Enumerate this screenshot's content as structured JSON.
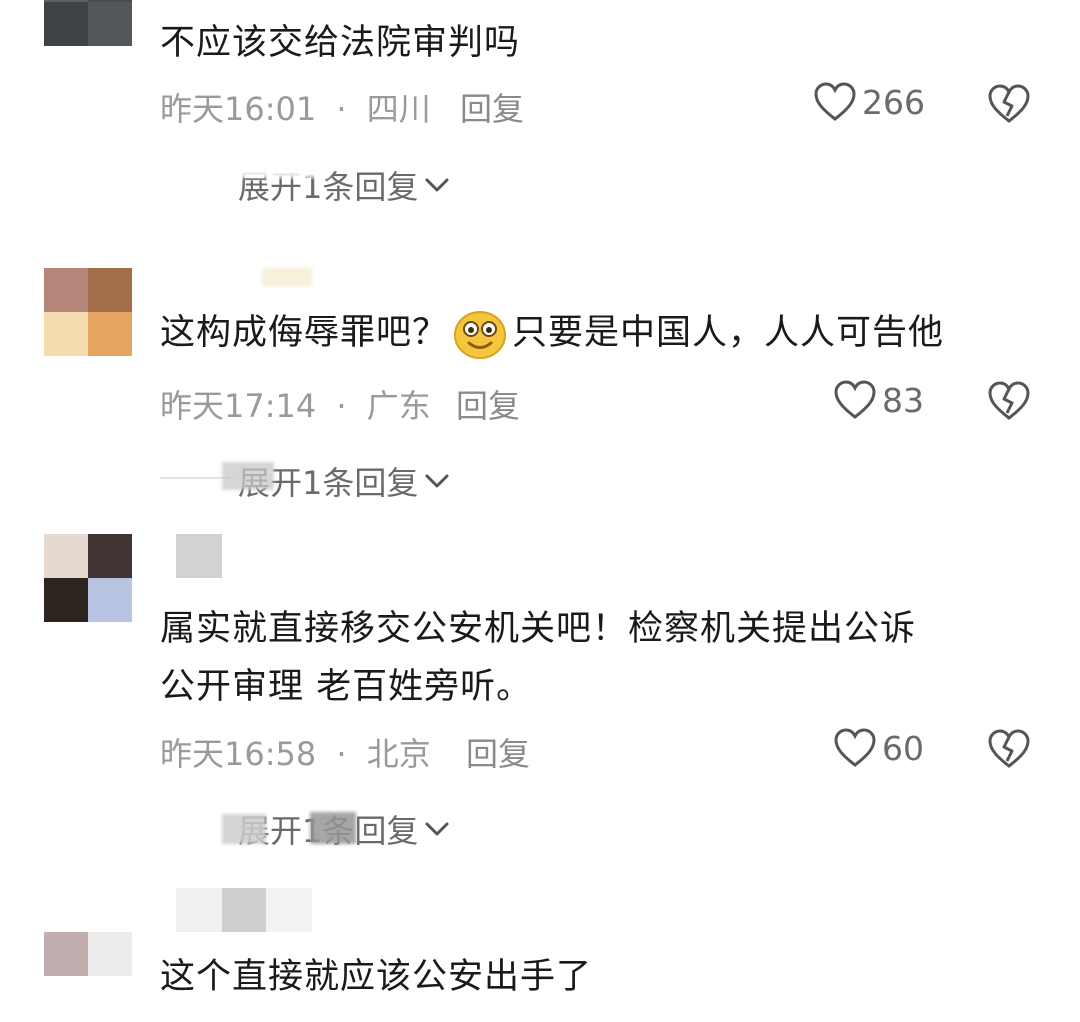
{
  "comments": [
    {
      "text": "不应该交给法院审判吗",
      "time": "昨天16:01",
      "location": "四川",
      "reply": "回复",
      "likes": "266",
      "expand": "展开1条回复"
    },
    {
      "text_before_emoji": "这构成侮辱罪吧？",
      "text_after_emoji": "只要是中国人，人人可告他",
      "emoji": "smiling-face-emoji",
      "time": "昨天17:14",
      "location": "广东",
      "reply": "回复",
      "likes": "83",
      "expand": "展开1条回复"
    },
    {
      "text_line1": "属实就直接移交公安机关吧！检察机关提出公诉",
      "text_line2": "公开审理 老百姓旁听。",
      "time": "昨天16:58",
      "location": "北京",
      "reply": "回复",
      "likes": "60",
      "expand": "展开1条回复"
    },
    {
      "text": "这个直接就应该公安出手了"
    }
  ],
  "separator": "·",
  "colors": {
    "text": "#1a1a1a",
    "meta": "#9a9a9a",
    "icon": "#555555"
  }
}
